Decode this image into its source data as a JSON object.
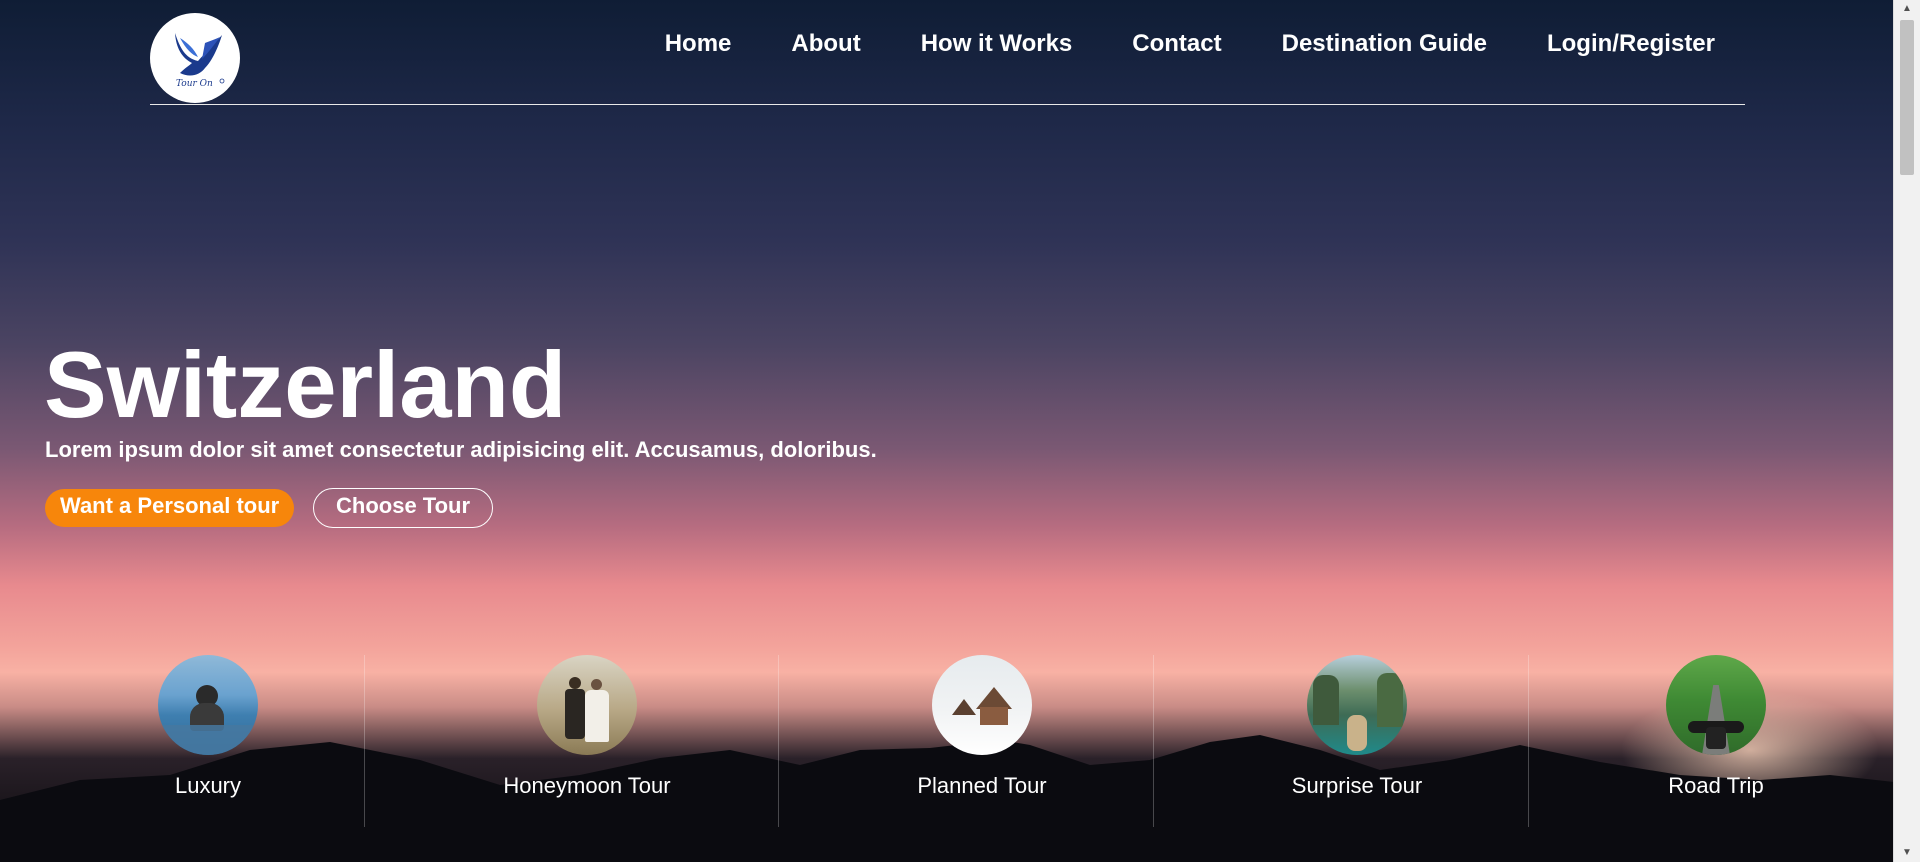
{
  "brand": {
    "logo_text": "Tour On",
    "icon": "bird-logo-icon"
  },
  "nav": [
    {
      "label": "Home"
    },
    {
      "label": "About"
    },
    {
      "label": "How it Works"
    },
    {
      "label": "Contact"
    },
    {
      "label": "Destination Guide"
    },
    {
      "label": "Login/Register"
    }
  ],
  "hero": {
    "title": "Switzerland",
    "subtitle": "Lorem ipsum dolor sit amet consectetur adipisicing elit. Accusamus, doloribus.",
    "primary_button": "Want a Personal tour",
    "secondary_button": "Choose Tour"
  },
  "tours": [
    {
      "label": "Luxury",
      "icon": "pool-photo"
    },
    {
      "label": "Honeymoon Tour",
      "icon": "couple-photo"
    },
    {
      "label": "Planned Tour",
      "icon": "snow-cabin-photo"
    },
    {
      "label": "Surprise Tour",
      "icon": "boat-photo"
    },
    {
      "label": "Road Trip",
      "icon": "motorbike-road-photo"
    }
  ],
  "colors": {
    "accent": "#f7860b",
    "sky_top": "#0f1d35",
    "sky_horizon": "#f8b1a4"
  }
}
